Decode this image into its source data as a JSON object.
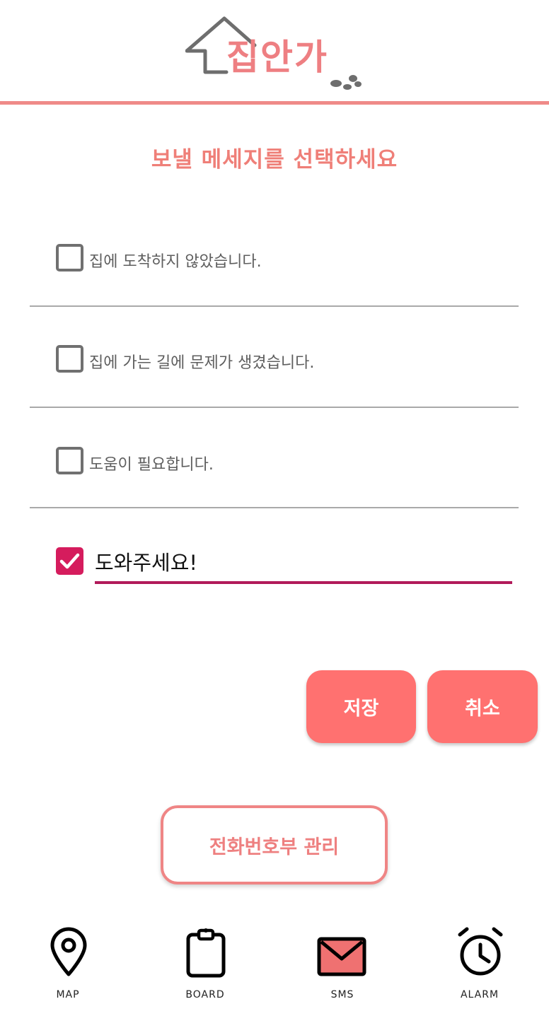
{
  "app": {
    "logo_text": "집안가"
  },
  "page_title": "보낼 메세지를 선택하세요",
  "options": [
    {
      "label": "집에 도착하지 않았습니다.",
      "checked": false
    },
    {
      "label": "집에 가는 길에 문제가 생겼습니다.",
      "checked": false
    },
    {
      "label": "도움이 필요합니다.",
      "checked": false
    }
  ],
  "custom_message": {
    "value": "도와주세요!",
    "checked": true
  },
  "buttons": {
    "save": "저장",
    "cancel": "취소",
    "phonebook": "전화번호부 관리"
  },
  "nav": [
    {
      "label": "MAP",
      "icon": "map-pin-icon"
    },
    {
      "label": "BOARD",
      "icon": "clipboard-icon"
    },
    {
      "label": "SMS",
      "icon": "mail-icon"
    },
    {
      "label": "ALARM",
      "icon": "alarm-clock-icon"
    }
  ],
  "colors": {
    "accent": "#ef8a88",
    "button": "#ff7170",
    "checked": "#d51c5d"
  }
}
